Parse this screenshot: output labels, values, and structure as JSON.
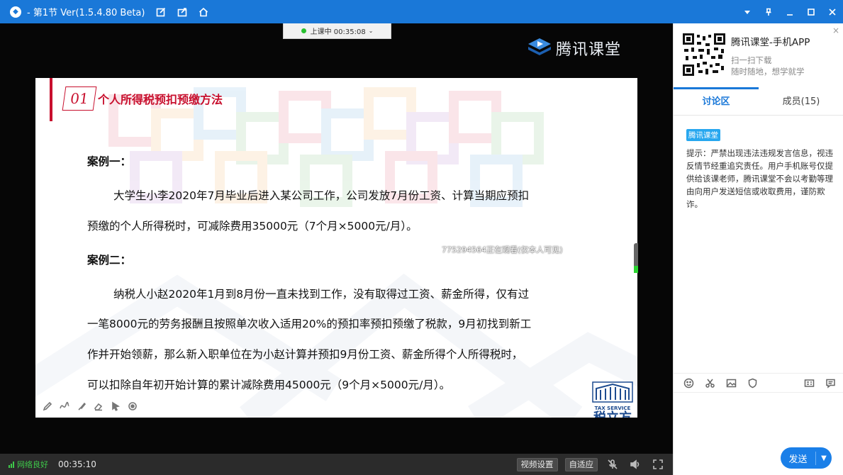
{
  "window": {
    "title": "- 第1节 Ver(1.5.4.80 Beta)"
  },
  "live": {
    "status": "上课中 00:35:08",
    "chevron": "⌄"
  },
  "brand": {
    "name": "腾讯课堂"
  },
  "slide": {
    "number": "01",
    "title": "个人所得税预扣预缴方法",
    "case1_heading": "案例一：",
    "case1_line1": "大学生小李2020年7月毕业后进入某公司工作，公司发放7月份工资、计算当期应预扣",
    "case1_line2": "预缴的个人所得税时，可减除费用35000元（7个月×5000元/月）。",
    "case2_heading": "案例二：",
    "case2_line1": "纳税人小赵2020年1月到8月份一直未找到工作，没有取得过工资、薪金所得，仅有过",
    "case2_line2": "一笔8000元的劳务报酬且按照单次收入适用20%的预扣率预扣预缴了税款，9月初找到新工",
    "case2_line3": "作并开始领薪，那么新入职单位在为小赵计算并预扣9月份工资、薪金所得个人所得税时，",
    "case2_line4": "可以扣除自年初开始计算的累计减除费用45000元（9个月×5000元/月）。",
    "watermark": "775294564正在观看(仅本人可见)",
    "logo_en": "TAX SERVICE",
    "logo_zh": "税立方"
  },
  "statusbar": {
    "network": "网络良好",
    "elapsed": "00:35:10",
    "video_settings": "视频设置",
    "fit": "自适应"
  },
  "panel": {
    "promo_title": "腾讯课堂-手机APP",
    "promo_line1": "扫一扫下载",
    "promo_line2": "随时随地，想学就学",
    "close": "×",
    "tab_discussion": "讨论区",
    "tab_members": "成员(15)",
    "notice_tag": "腾讯课堂",
    "notice_text": "提示：严禁出现违法违规发言信息，视违反情节经重追究责任。用户手机账号仅提供给该课老师，腾讯课堂不会以考勤等理由向用户发送短信或收取费用，谨防欺诈。",
    "send": "发送",
    "send_arrow": "▼"
  },
  "colors": {
    "titlebar": "#1a78d8",
    "accent_red": "#c8102e",
    "send_blue": "#1a7fe8",
    "network_green": "#3ec94a"
  }
}
